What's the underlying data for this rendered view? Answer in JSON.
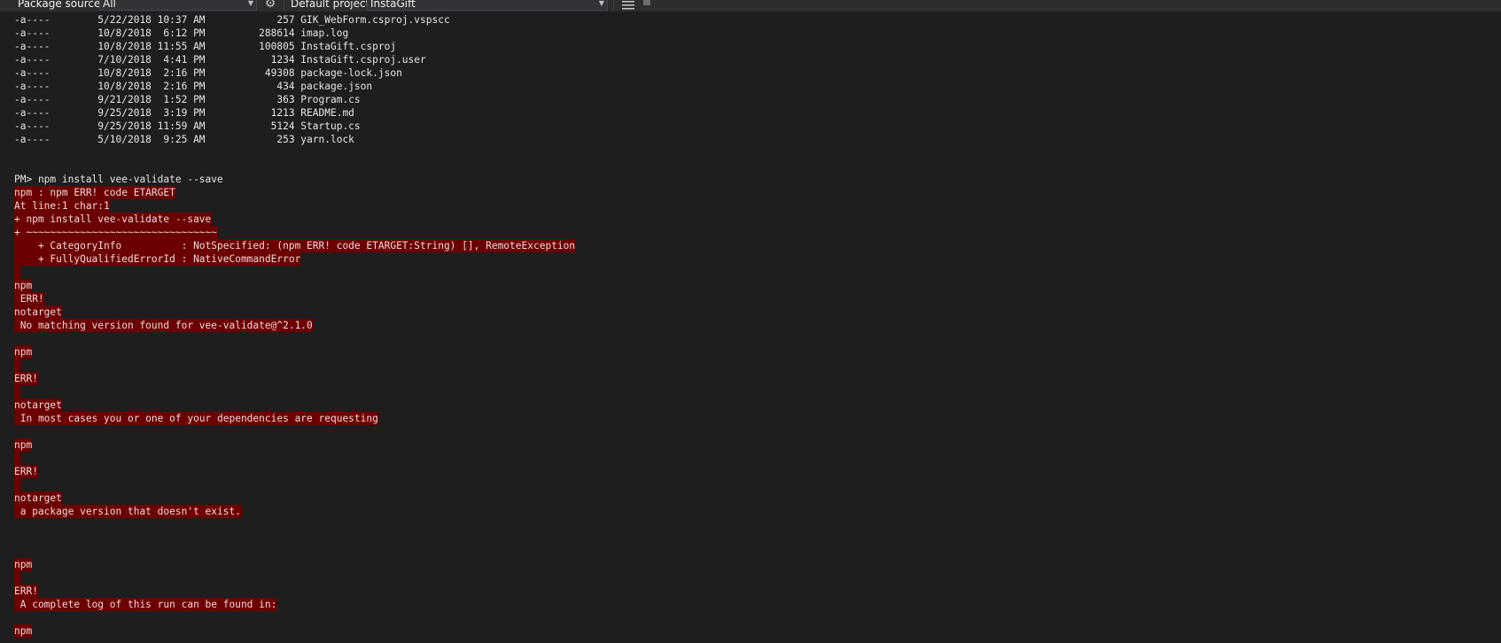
{
  "toolbar": {
    "package_source_label": "Package source:",
    "package_source_value": "All",
    "default_project_label": "Default project:",
    "default_project_value": "InstaGift"
  },
  "listing": [
    {
      "mode": "-a----",
      "date": "5/22/2018",
      "time": "10:37 AM",
      "size": "257",
      "name": "GIK_WebForm.csproj.vspscc"
    },
    {
      "mode": "-a----",
      "date": "10/8/2018",
      "time": "6:12 PM",
      "size": "288614",
      "name": "imap.log"
    },
    {
      "mode": "-a----",
      "date": "10/8/2018",
      "time": "11:55 AM",
      "size": "100805",
      "name": "InstaGift.csproj"
    },
    {
      "mode": "-a----",
      "date": "7/10/2018",
      "time": "4:41 PM",
      "size": "1234",
      "name": "InstaGift.csproj.user"
    },
    {
      "mode": "-a----",
      "date": "10/8/2018",
      "time": "2:16 PM",
      "size": "49308",
      "name": "package-lock.json"
    },
    {
      "mode": "-a----",
      "date": "10/8/2018",
      "time": "2:16 PM",
      "size": "434",
      "name": "package.json"
    },
    {
      "mode": "-a----",
      "date": "9/21/2018",
      "time": "1:52 PM",
      "size": "363",
      "name": "Program.cs"
    },
    {
      "mode": "-a----",
      "date": "9/25/2018",
      "time": "3:19 PM",
      "size": "1213",
      "name": "README.md"
    },
    {
      "mode": "-a----",
      "date": "9/25/2018",
      "time": "11:59 AM",
      "size": "5124",
      "name": "Startup.cs"
    },
    {
      "mode": "-a----",
      "date": "5/10/2018",
      "time": "9:25 AM",
      "size": "253",
      "name": "yarn.lock"
    }
  ],
  "console": {
    "prompt_command": "PM> npm install vee-validate --save",
    "error_line_1": "npm : npm ERR! code ETARGET",
    "error_line_2": "At line:1 char:1",
    "error_line_3": "+ npm install vee-validate --save",
    "error_line_4": "+ ~~~~~~~~~~~~~~~~~~~~~~~~~~~~~~~~",
    "error_line_5": "    + CategoryInfo          : NotSpecified: (npm ERR! code ETARGET:String) [], RemoteException",
    "error_line_6": "    + FullyQualifiedErrorId : NativeCommandError",
    "msg_npm_1": "npm",
    "msg_err_1": " ERR!",
    "msg_notarget_1": "notarget",
    "msg_text_1": " No matching version found for vee-validate@^2.1.0",
    "msg_npm_2": "npm",
    "msg_err_2": "ERR!",
    "msg_notarget_2": "notarget",
    "msg_text_2": " In most cases you or one of your dependencies are requesting",
    "msg_npm_3": "npm",
    "msg_err_3": "ERR!",
    "msg_notarget_3": "notarget",
    "msg_text_3": " a package version that doesn't exist.",
    "msg_npm_4": "npm",
    "msg_err_4": "ERR!",
    "msg_text_4": " A complete log of this run can be found in:",
    "msg_npm_5": "npm"
  }
}
